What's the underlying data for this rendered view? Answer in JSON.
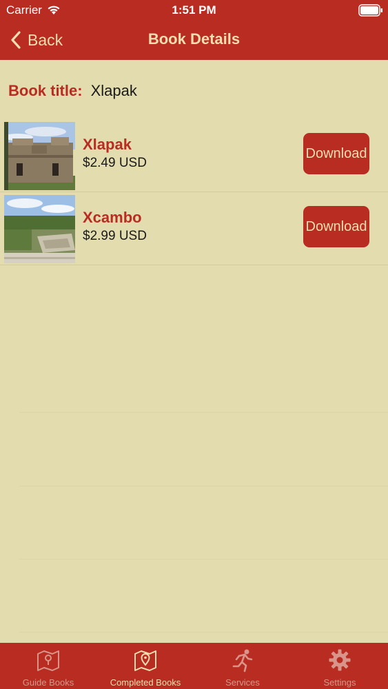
{
  "status_bar": {
    "carrier": "Carrier",
    "time": "1:51 PM"
  },
  "nav": {
    "back_label": "Back",
    "title": "Book Details"
  },
  "book_title": {
    "label": "Book title:",
    "value": "Xlapak"
  },
  "books": [
    {
      "name": "Xlapak",
      "price": "$2.49 USD",
      "button": "Download",
      "image_icon": "ruins-building-photo"
    },
    {
      "name": "Xcambo",
      "price": "$2.99 USD",
      "button": "Download",
      "image_icon": "ruins-pyramid-photo"
    }
  ],
  "tab_bar": {
    "tabs": [
      {
        "label": "Guide Books",
        "icon": "map-icon",
        "active": false
      },
      {
        "label": "Completed Books",
        "icon": "map-pin-icon",
        "active": true
      },
      {
        "label": "Services",
        "icon": "running-person-icon",
        "active": false
      },
      {
        "label": "Settings",
        "icon": "gear-icon",
        "active": false
      }
    ]
  },
  "colors": {
    "brand_red": "#b82c22",
    "background": "#e3dcaf",
    "light_text": "#f2deb0",
    "inactive_tab": "#d9958a"
  }
}
